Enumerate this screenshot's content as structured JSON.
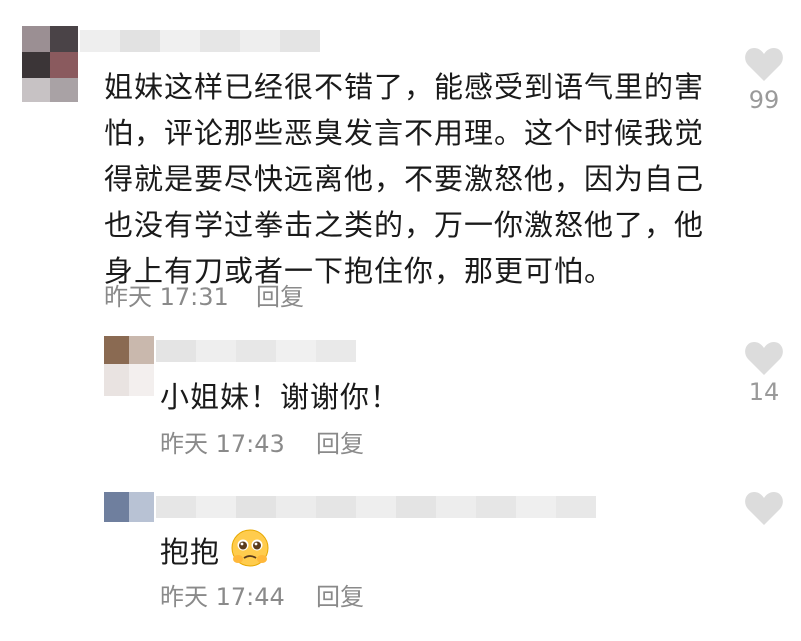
{
  "comments": [
    {
      "lines": [
        "姐妹这样已经很不错了，能感受到语气里的害",
        "怕，评论那些恶臭发言不用理。这个时候我觉",
        "得就是要尽快远离他，不要激怒他，因为自己",
        "也没有学过拳击之类的，万一你激怒他了，他",
        "身上有刀或者一下抱住你，那更可怕。"
      ],
      "time": "昨天 17:31",
      "reply_label": "回复",
      "likes": "99"
    }
  ],
  "replies": [
    {
      "text": "小姐妹！谢谢你！",
      "time": "昨天 17:43",
      "reply_label": "回复",
      "likes": "14"
    },
    {
      "text": "抱抱",
      "emoji": "🥺",
      "time": "昨天 17:44",
      "reply_label": "回复",
      "likes": ""
    }
  ],
  "colors": {
    "text": "#1a1a1a",
    "meta": "#8a8a8a",
    "heart": "#dcdcdc"
  },
  "icons": [
    "heart-icon",
    "pleading-face-emoji"
  ]
}
